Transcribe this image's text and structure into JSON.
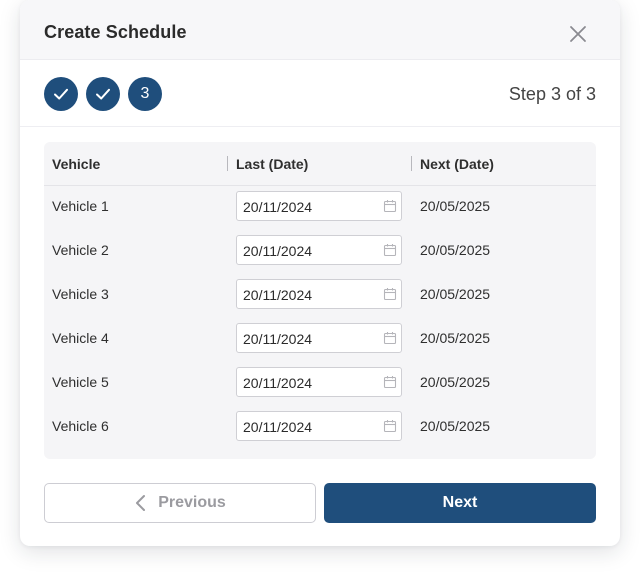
{
  "dialog": {
    "title": "Create Schedule",
    "close_icon": "close-icon"
  },
  "stepper": {
    "steps": [
      {
        "state": "completed",
        "icon": "check-icon"
      },
      {
        "state": "completed",
        "icon": "check-icon"
      },
      {
        "state": "current",
        "label": "3"
      }
    ],
    "counter": "Step 3 of 3"
  },
  "table": {
    "columns": [
      "Vehicle",
      "Last (Date)",
      "Next (Date)"
    ],
    "rows": [
      {
        "vehicle": "Vehicle 1",
        "last": "20/11/2024",
        "next": "20/05/2025"
      },
      {
        "vehicle": "Vehicle 2",
        "last": "20/11/2024",
        "next": "20/05/2025"
      },
      {
        "vehicle": "Vehicle 3",
        "last": "20/11/2024",
        "next": "20/05/2025"
      },
      {
        "vehicle": "Vehicle 4",
        "last": "20/11/2024",
        "next": "20/05/2025"
      },
      {
        "vehicle": "Vehicle 5",
        "last": "20/11/2024",
        "next": "20/05/2025"
      },
      {
        "vehicle": "Vehicle 6",
        "last": "20/11/2024",
        "next": "20/05/2025"
      }
    ]
  },
  "footer": {
    "previous_label": "Previous",
    "next_label": "Next"
  },
  "colors": {
    "primary": "#1f4e7c",
    "header_bg": "#f7f7f9",
    "table_bg": "#f5f5f7",
    "disabled_text": "#9b9ba0"
  }
}
